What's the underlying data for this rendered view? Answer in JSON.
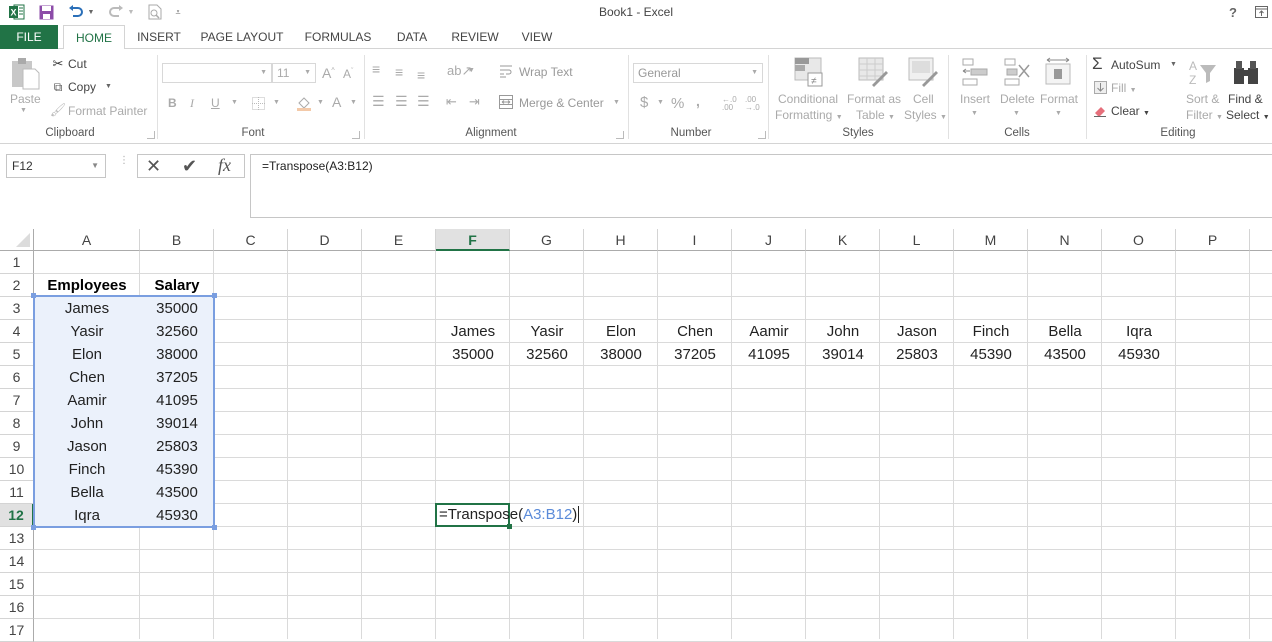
{
  "window": {
    "title": "Book1 - Excel",
    "help": "?"
  },
  "qat": {
    "excel_icon": "excel-logo-icon",
    "save": "save-icon",
    "undo": "undo-icon",
    "redo": "redo-icon",
    "print_preview": "print-preview-icon",
    "customize": "customize-qat-icon"
  },
  "tabs": [
    {
      "label": "FILE"
    },
    {
      "label": "HOME"
    },
    {
      "label": "INSERT"
    },
    {
      "label": "PAGE LAYOUT"
    },
    {
      "label": "FORMULAS"
    },
    {
      "label": "DATA"
    },
    {
      "label": "REVIEW"
    },
    {
      "label": "VIEW"
    }
  ],
  "ribbon": {
    "clipboard": {
      "label": "Clipboard",
      "paste": "Paste",
      "cut": "Cut",
      "copy": "Copy",
      "format_painter": "Format Painter"
    },
    "font": {
      "label": "Font",
      "font_name": "",
      "font_size": "11",
      "bold": "B",
      "italic": "I",
      "underline": "U",
      "font_color": "A"
    },
    "alignment": {
      "label": "Alignment",
      "wrap_text": "Wrap Text",
      "merge_center": "Merge & Center"
    },
    "number": {
      "label": "Number",
      "format": "General",
      "currency": "$",
      "percent": "%",
      "comma": ",",
      "inc_decimal": "←.0 .00",
      "dec_decimal": ".00 →.0"
    },
    "styles": {
      "label": "Styles",
      "conditional_1": "Conditional",
      "conditional_2": "Formatting",
      "format_table_1": "Format as",
      "format_table_2": "Table",
      "cell_styles_1": "Cell",
      "cell_styles_2": "Styles"
    },
    "cells": {
      "label": "Cells",
      "insert": "Insert",
      "delete": "Delete",
      "format": "Format"
    },
    "editing": {
      "label": "Editing",
      "autosum": "AutoSum",
      "fill": "Fill",
      "clear": "Clear",
      "sort_1": "Sort &",
      "sort_2": "Filter",
      "find_1": "Find &",
      "find_2": "Select"
    }
  },
  "formula_bar": {
    "name_box": "F12",
    "fx": "fx",
    "formula": "=Transpose(A3:B12)"
  },
  "sheet": {
    "columns": [
      "A",
      "B",
      "C",
      "D",
      "E",
      "F",
      "G",
      "H",
      "I",
      "J",
      "K",
      "L",
      "M",
      "N",
      "O",
      "P"
    ],
    "rows": [
      "1",
      "2",
      "3",
      "4",
      "5",
      "6",
      "7",
      "8",
      "9",
      "10",
      "11",
      "12",
      "13",
      "14",
      "15",
      "16",
      "17"
    ],
    "selected_column": "F",
    "selected_row": "12",
    "headers": {
      "employees": "Employees",
      "salary": "Salary"
    },
    "source": [
      {
        "name": "James",
        "salary": "35000"
      },
      {
        "name": "Yasir",
        "salary": "32560"
      },
      {
        "name": "Elon",
        "salary": "38000"
      },
      {
        "name": "Chen",
        "salary": "37205"
      },
      {
        "name": "Aamir",
        "salary": "41095"
      },
      {
        "name": "John",
        "salary": "39014"
      },
      {
        "name": "Jason",
        "salary": "25803"
      },
      {
        "name": "Finch",
        "salary": "45390"
      },
      {
        "name": "Bella",
        "salary": "43500"
      },
      {
        "name": "Iqra",
        "salary": "45930"
      }
    ],
    "transposed_names": [
      "James",
      "Yasir",
      "Elon",
      "Chen",
      "Aamir",
      "John",
      "Jason",
      "Finch",
      "Bella",
      "Iqra"
    ],
    "transposed_salaries": [
      "35000",
      "32560",
      "38000",
      "37205",
      "41095",
      "39014",
      "25803",
      "45390",
      "43500",
      "45930"
    ],
    "edit_cell": {
      "prefix": "=Transpose(",
      "ref": "A3:B12",
      "suffix": ")"
    }
  },
  "colors": {
    "accent": "#217346",
    "range_highlight": "#7a9ee0",
    "range_fill": "#ebf1fb"
  }
}
